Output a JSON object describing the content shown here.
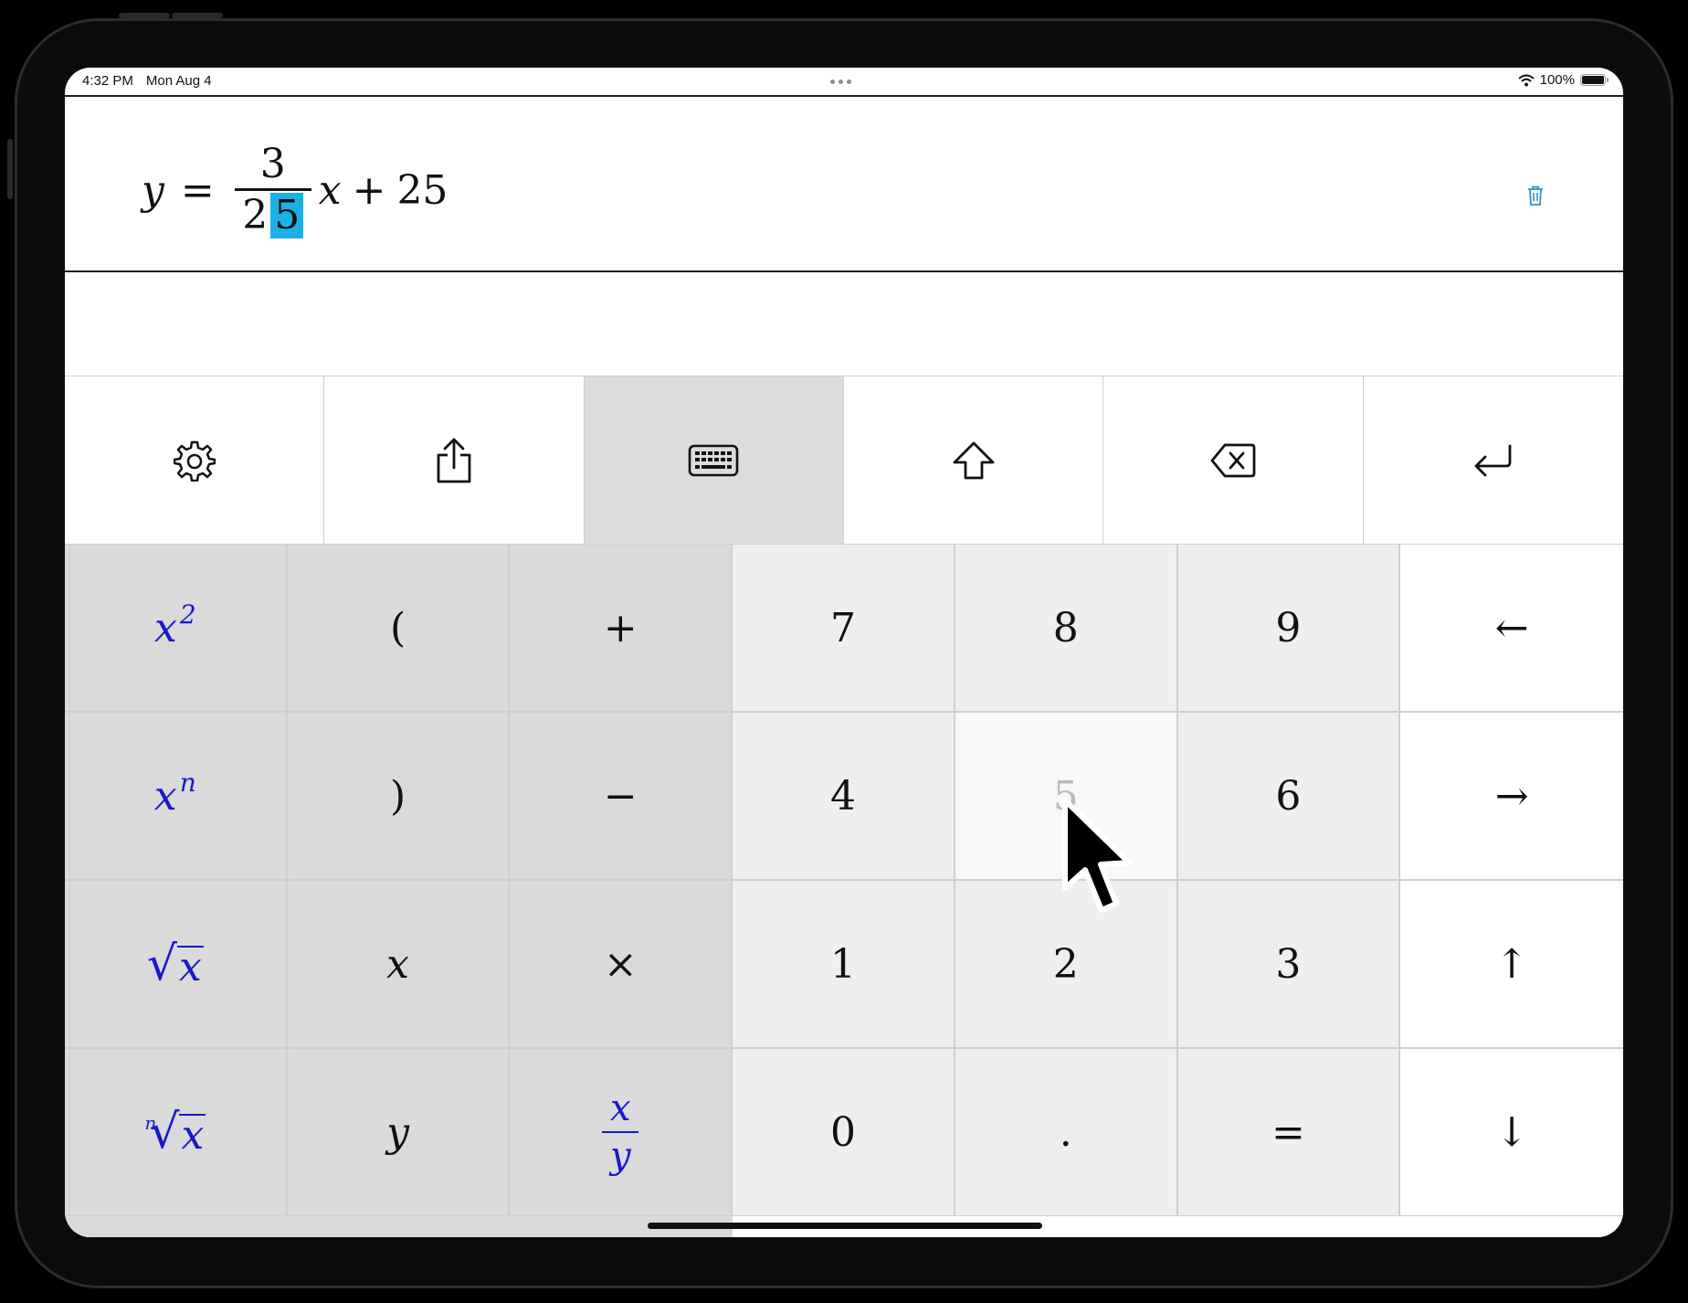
{
  "status_bar": {
    "time": "4:32 PM",
    "date": "Mon Aug 4",
    "battery": "100%"
  },
  "equation": {
    "y": "y",
    "equals": "=",
    "numerator": "3",
    "denominator_plain": "2",
    "denominator_selected": "5",
    "x": "x",
    "plus": "+",
    "constant": "25"
  },
  "toolbar": {
    "items": [
      "gear-icon",
      "share-icon",
      "keyboard-icon",
      "shift-icon",
      "delete-icon",
      "return-icon"
    ],
    "active": "keyboard-icon"
  },
  "keys": {
    "x_squared": {
      "base": "x",
      "exp": "2"
    },
    "x_power_n": {
      "base": "x",
      "exp": "n"
    },
    "sqrt": {
      "radical": "√",
      "body": "x"
    },
    "nth_root": {
      "index": "n",
      "radical": "√",
      "body": "x"
    },
    "open_paren": "(",
    "close_paren": ")",
    "var_x": "x",
    "var_y": "y",
    "plus": "+",
    "minus": "−",
    "times": "×",
    "fraction": {
      "num": "x",
      "den": "y"
    },
    "digits": {
      "seven": "7",
      "eight": "8",
      "nine": "9",
      "four": "4",
      "five": "5",
      "six": "6",
      "one": "1",
      "two": "2",
      "three": "3",
      "zero": "0"
    },
    "decimal": ".",
    "equals": "=",
    "arrows": {
      "left": "←",
      "right": "→",
      "up": "↑",
      "down": "↓"
    }
  },
  "colors": {
    "selection": "#1ab2e6",
    "function_key_text": "#1818cc",
    "function_key_bg": "#dadada",
    "digit_key_bg": "#efefef",
    "trash_icon": "#2f8fe0"
  }
}
